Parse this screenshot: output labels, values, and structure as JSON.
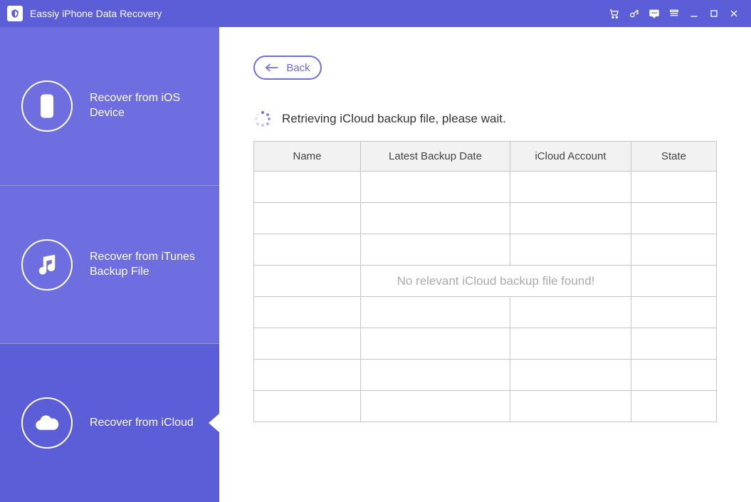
{
  "app": {
    "title": "Eassiy iPhone Data Recovery"
  },
  "sidebar": {
    "items": [
      {
        "label": "Recover from iOS Device"
      },
      {
        "label": "Recover from iTunes Backup File"
      },
      {
        "label": "Recover from iCloud"
      }
    ]
  },
  "main": {
    "back_label": "Back",
    "status_text": "Retrieving iCloud backup file, please wait.",
    "table": {
      "headers": {
        "name": "Name",
        "date": "Latest Backup Date",
        "account": "iCloud Account",
        "state": "State"
      },
      "empty_message": "No relevant iCloud backup file found!"
    }
  }
}
